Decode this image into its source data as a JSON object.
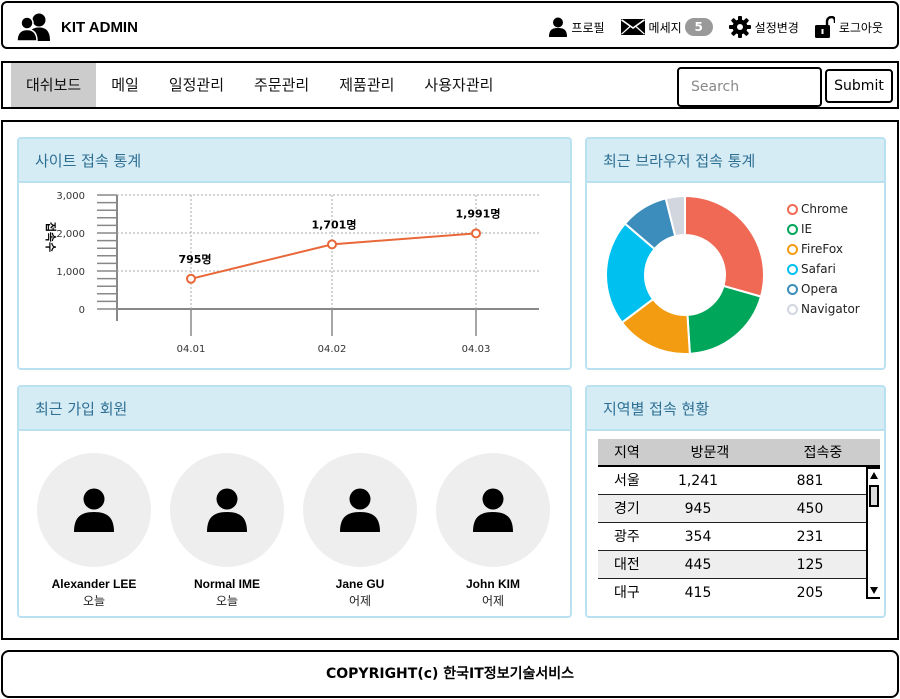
{
  "header": {
    "brand": "KIT ADMIN",
    "menu": [
      {
        "icon": "user-icon",
        "label": "프로필"
      },
      {
        "icon": "mail-icon",
        "label": "메세지",
        "badge": "5"
      },
      {
        "icon": "gear-icon",
        "label": "설정변경"
      },
      {
        "icon": "unlock-icon",
        "label": "로그아웃"
      }
    ]
  },
  "nav": {
    "tabs": [
      "대쉬보드",
      "메일",
      "일정관리",
      "주문관리",
      "제품관리",
      "사용자관리"
    ],
    "active_index": 0,
    "search_placeholder": "Search",
    "submit_label": "Submit"
  },
  "panels": {
    "site": {
      "title": "사이트 접속 통계",
      "chart_data": {
        "type": "line",
        "x": [
          "04.01",
          "04.02",
          "04.03"
        ],
        "values": [
          795,
          1701,
          1991
        ],
        "point_labels": [
          "795명",
          "1,701명",
          "1,991명"
        ],
        "ylabel": "접속수",
        "y_ticks": [
          "0",
          "1,000",
          "2,000",
          "3,000"
        ],
        "ylim": [
          0,
          3000
        ],
        "grid": true,
        "line_color": "#e8683a"
      }
    },
    "browser": {
      "title": "최근 브라우저 접속 통계",
      "chart_data": {
        "type": "pie",
        "categories": [
          "Chrome",
          "IE",
          "FireFox",
          "Safari",
          "Opera",
          "Navigator"
        ],
        "values": [
          30,
          20,
          16,
          22,
          10,
          4
        ],
        "colors": [
          "#f06955",
          "#00a65a",
          "#f39c12",
          "#00c0ef",
          "#3c8dbc",
          "#d2d6de"
        ],
        "legend": "right"
      }
    },
    "members": {
      "title": "최근 가입 회원",
      "items": [
        {
          "name": "Alexander LEE",
          "when": "오늘"
        },
        {
          "name": "Normal IME",
          "when": "오늘"
        },
        {
          "name": "Jane GU",
          "when": "어제"
        },
        {
          "name": "John KIM",
          "when": "어제"
        }
      ]
    },
    "region": {
      "title": "지역별 접속 현황",
      "columns": [
        "지역",
        "방문객",
        "접속중"
      ],
      "rows": [
        [
          "서울",
          "1,241",
          "881"
        ],
        [
          "경기",
          "945",
          "450"
        ],
        [
          "광주",
          "354",
          "231"
        ],
        [
          "대전",
          "445",
          "125"
        ],
        [
          "대구",
          "415",
          "205"
        ]
      ]
    }
  },
  "footer": {
    "text": "COPYRIGHT(c) 한국IT정보기술서비스"
  }
}
